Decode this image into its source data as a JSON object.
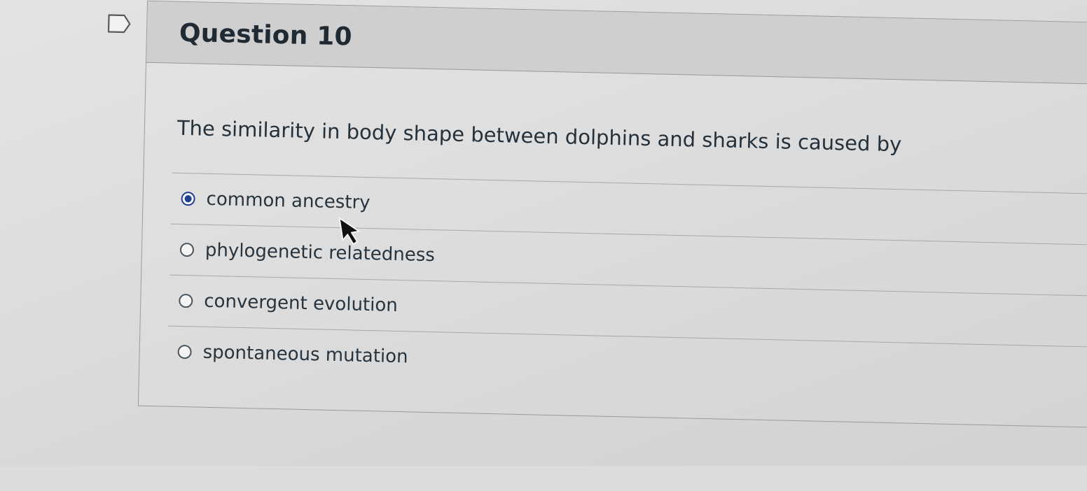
{
  "question": {
    "title": "Question 10",
    "prompt": "The similarity in body shape between dolphins and sharks is caused by",
    "flag_icon": "bookmark-flag-icon"
  },
  "answers": [
    {
      "label": "common ancestry",
      "selected": true
    },
    {
      "label": "phylogenetic relatedness",
      "selected": false
    },
    {
      "label": "convergent evolution",
      "selected": false
    },
    {
      "label": "spontaneous mutation",
      "selected": false
    }
  ],
  "colors": {
    "selected_radio": "#1d3f8f",
    "text": "#24313b",
    "header_bg": "#cfcfcf"
  },
  "pointer": {
    "icon": "mouse-pointer-icon"
  }
}
